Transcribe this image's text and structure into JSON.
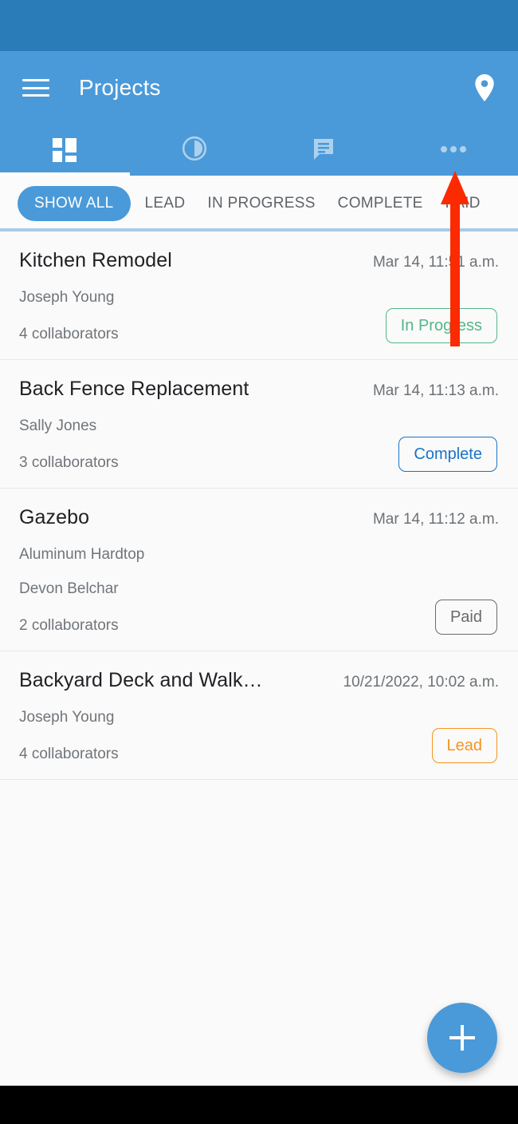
{
  "app_bar": {
    "title": "Projects",
    "menu_icon": "hamburger-menu-icon",
    "location_icon": "map-pin-icon"
  },
  "tabs": [
    {
      "icon": "dashboard-grid-icon",
      "active": true
    },
    {
      "icon": "pie-chart-clock-icon",
      "active": false
    },
    {
      "icon": "chat-bubble-icon",
      "active": false
    },
    {
      "icon": "more-horizontal-icon",
      "active": false
    }
  ],
  "filters": {
    "selected": "SHOW ALL",
    "items": [
      {
        "label": "SHOW ALL",
        "active": true
      },
      {
        "label": "LEAD",
        "active": false
      },
      {
        "label": "IN PROGRESS",
        "active": false
      },
      {
        "label": "COMPLETE",
        "active": false
      },
      {
        "label": "PAID",
        "active": false
      }
    ]
  },
  "projects": [
    {
      "title": "Kitchen Remodel",
      "date": "Mar 14, 11:51 a.m.",
      "subtitle": "",
      "owner": "Joseph Young",
      "collaborators": "4 collaborators",
      "status": "In Progress",
      "status_color": "#52b788"
    },
    {
      "title": "Back Fence Replacement",
      "date": "Mar 14, 11:13 a.m.",
      "subtitle": "",
      "owner": "Sally Jones",
      "collaborators": "3 collaborators",
      "status": "Complete",
      "status_color": "#1a73c8"
    },
    {
      "title": "Gazebo",
      "date": "Mar 14, 11:12 a.m.",
      "subtitle": "Aluminum Hardtop",
      "owner": "Devon Belchar",
      "collaborators": "2 collaborators",
      "status": "Paid",
      "status_color": "#6b6b6b"
    },
    {
      "title": "Backyard Deck and Walk…",
      "date": "10/21/2022, 10:02 a.m.",
      "subtitle": "",
      "owner": "Joseph Young",
      "collaborators": "4 collaborators",
      "status": "Lead",
      "status_color": "#f7941e"
    }
  ],
  "fab": {
    "icon": "plus-icon",
    "label": "+"
  },
  "annotation": {
    "arrow_color": "#fc2a00",
    "points_at": "more-horizontal-icon"
  },
  "colors": {
    "status_bar": "#2a7cb8",
    "app_bar": "#4a9ad9",
    "accent": "#4a9ad9",
    "page_background": "#fafafa",
    "filter_divider": "#a8cbe8"
  }
}
